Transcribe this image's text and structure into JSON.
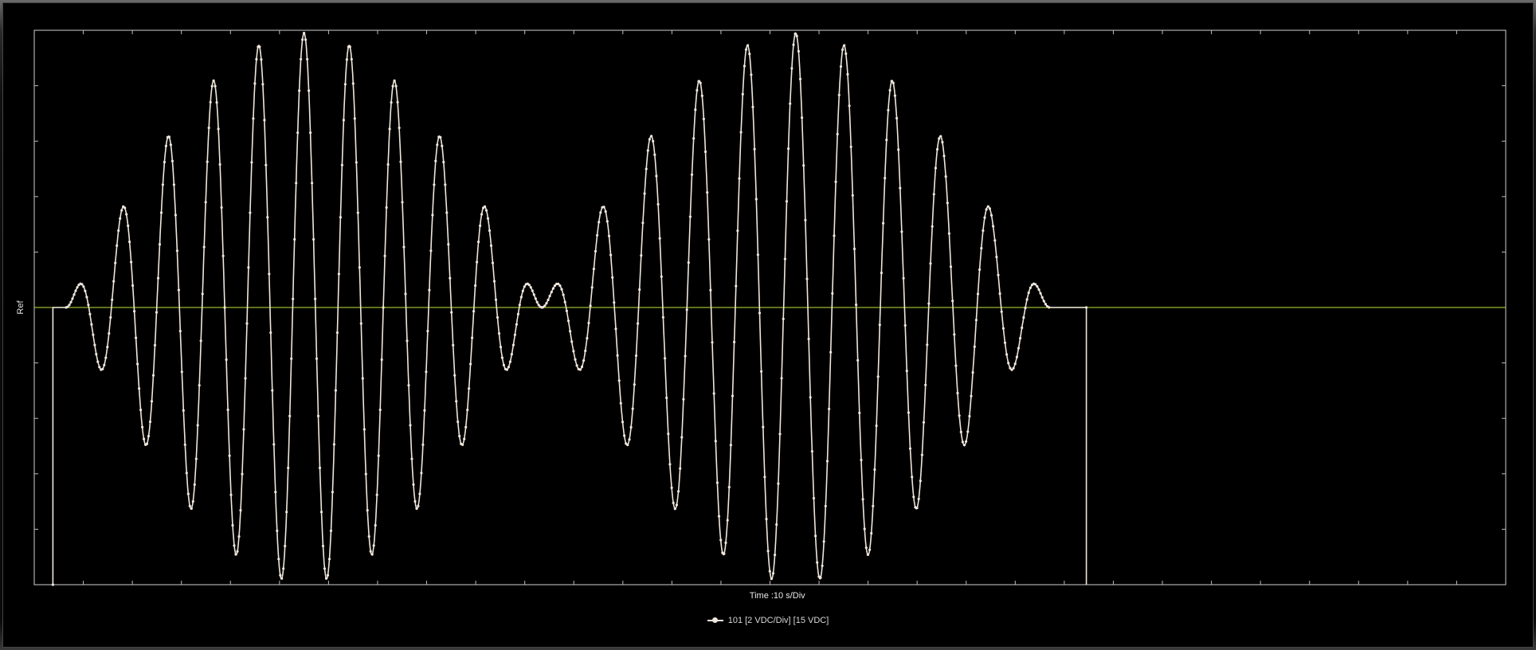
{
  "chart_data": {
    "type": "line",
    "ylabel": "Ref",
    "xlabel": "Time :10 s/Div",
    "legend_placement": "bottom-center",
    "grid": false,
    "colors": {
      "background": "#000000",
      "trace": "#efe6dc",
      "reference_line": "#9ab82a",
      "axis_frame": "#d0d0d0"
    },
    "x_divisions": 30,
    "y_divisions": 10,
    "reference_level_div": 5,
    "series": [
      {
        "name": "101 [2 VDC/Div]  [15 VDC]",
        "marker": "circle",
        "segments": [
          {
            "type": "flat",
            "t_start": 0.3,
            "t_end": 0.65,
            "level_div": 0
          },
          {
            "type": "burst",
            "t_start": 0.65,
            "t_end": 10.35,
            "amplitude_div": 4.95,
            "cycles": 10.5,
            "envelope": "sine-hump"
          },
          {
            "type": "burst",
            "t_start": 10.35,
            "t_end": 20.7,
            "amplitude_div": 4.95,
            "cycles": 10.5,
            "envelope": "sine-hump"
          },
          {
            "type": "flat",
            "t_start": 20.7,
            "t_end": 21.4,
            "level_div": 0
          },
          {
            "type": "step",
            "at": [
              0.38,
              21.45
            ],
            "to_div": -5
          }
        ]
      }
    ]
  }
}
